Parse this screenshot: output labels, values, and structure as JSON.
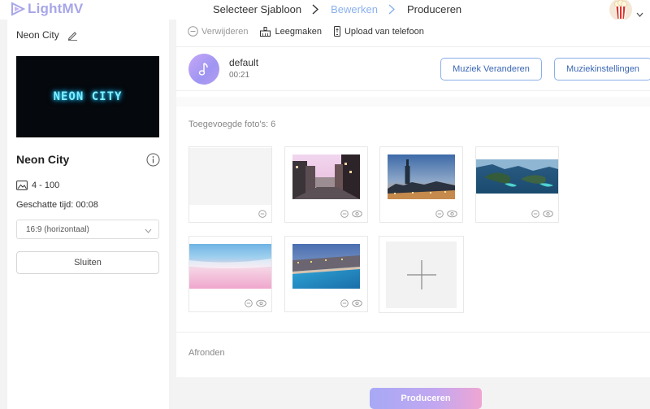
{
  "header": {
    "logo_text": "LightMV",
    "steps": [
      "Selecteer Sjabloon",
      "Bewerken",
      "Produceren"
    ],
    "active_step": 1
  },
  "left": {
    "template_name": "Neon City",
    "preview_text": "NEON CITY",
    "title": "Neon City",
    "photo_range": "4 - 100",
    "estimated_time": "Geschatte tijd: 00:08",
    "ratio_selected": "16:9 (horizontaal)",
    "close_label": "Sluiten"
  },
  "toolbar": {
    "delete_label": "Verwijderen",
    "clear_label": "Leegmaken",
    "upload_label": "Upload van telefoon"
  },
  "music": {
    "name": "default",
    "duration": "00:21",
    "change_label": "Muziek Veranderen",
    "settings_label": "Muziekinstellingen"
  },
  "photos": {
    "label": "Toegevoegde foto's: 6"
  },
  "finish": {
    "label": "Afronden"
  },
  "produce_label": "Produceren",
  "colors": {
    "accent": "#8aaeea",
    "logo": "#a7a6e8",
    "active_step": "#8ab0ee"
  }
}
